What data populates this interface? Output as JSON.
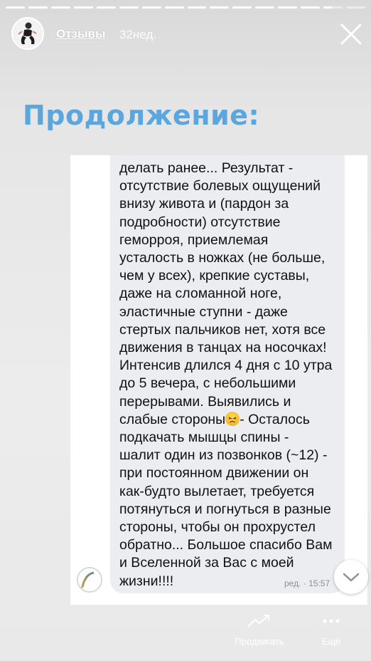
{
  "header": {
    "username": "Отзывы",
    "time": "32нед."
  },
  "progress": {
    "segments_total": 16,
    "segments_done": 14
  },
  "title": "Продолжение:",
  "message": {
    "lines": [
      "делать ранее... Результат -",
      "отсутствие болевых ощущений",
      "внизу живота и (пардон за",
      "подробности) отсутствие",
      "геморроя,  приемлемая",
      "усталость в ножках (не больше,",
      "чем у всех), крепкие суставы,",
      "даже на сломанной ноге,",
      "эластичные ступни - даже",
      "стертых пальчиков нет, хотя все",
      "движения в танцах на носочках!",
      "Интенсив длился 4 дня с 10 утра",
      "до 5 вечера, с небольшими",
      "перерывами. Выявились и",
      "слабые стороны",
      "- Осталось",
      "подкачать мышцы спины -",
      "шалит один из позвонков (~12) -",
      "при постоянном движении он",
      "как-будто вылетает, требуется",
      "потянуться и погнуться в разные",
      "стороны, чтобы он прохрустел",
      "обратно... Большое спасибо Вам",
      "и Вселенной за Вас с моей",
      "жизни!!!!"
    ],
    "meta": "ред. · 15:57"
  },
  "actions": {
    "promote_label": "Продвигать",
    "more_label": "Ещё"
  },
  "colors": {
    "title": "#5aa6dd",
    "bubble": "#ebedf0",
    "meta": "#8a9099"
  },
  "icons": {
    "close": "close-icon",
    "scroll_down": "chevron-down-icon",
    "promote": "trend-arrow-icon",
    "more": "more-dots-icon",
    "emoji": "tired-face-emoji"
  }
}
